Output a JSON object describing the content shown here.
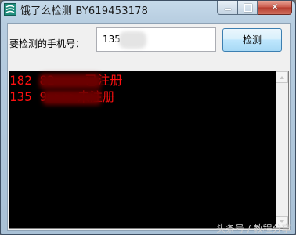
{
  "window": {
    "title": "饿了么检测 BY619453178",
    "close_symbol": "✕"
  },
  "form": {
    "phone_label": "要检测的手机号：",
    "phone_value": "135          9",
    "detect_button": "检测"
  },
  "results": [
    {
      "text": "182       82>>>>已注册"
    },
    {
      "text": "135        9>>>>未注册"
    }
  ],
  "watermark": "头条号 / 教程分享",
  "colors": {
    "console_background": "#000000",
    "result_text": "#ff1010"
  }
}
